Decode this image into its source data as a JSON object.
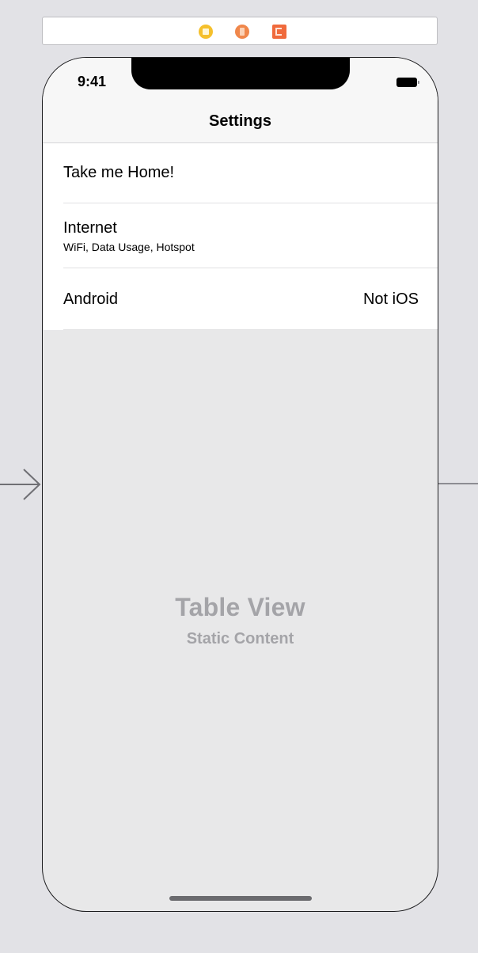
{
  "status_bar": {
    "time": "9:41"
  },
  "nav": {
    "title": "Settings"
  },
  "cells": [
    {
      "label": "Take me Home!"
    },
    {
      "label": "Internet",
      "subtitle": "WiFi, Data Usage, Hotspot"
    },
    {
      "label": "Android",
      "detail": "Not iOS"
    }
  ],
  "placeholder": {
    "title": "Table View",
    "subtitle": "Static Content"
  },
  "dock_icons": [
    "view-controller-icon",
    "first-responder-icon",
    "exit-icon"
  ],
  "colors": {
    "canvas_background": "#e2e2e6",
    "table_background": "#e8e8e9",
    "cell_background": "#ffffff",
    "placeholder_text": "#a4a4a8",
    "dock_vc": "#f5c02c",
    "dock_first_responder": "#f0874b",
    "dock_exit": "#f06a3c"
  }
}
